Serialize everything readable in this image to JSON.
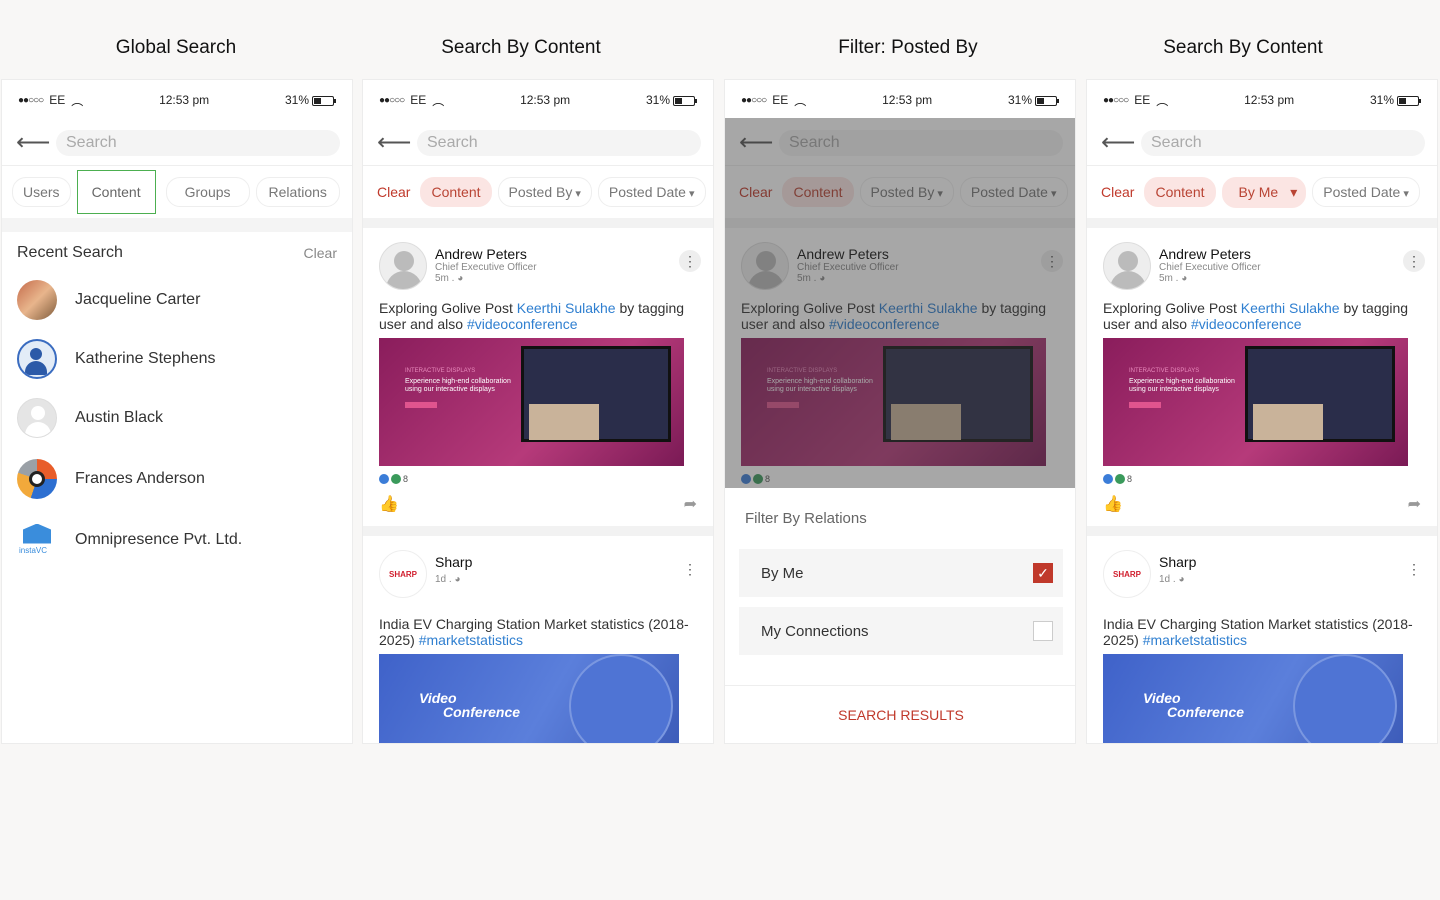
{
  "columns": [
    {
      "title": "Global Search"
    },
    {
      "title": "Search By Content"
    },
    {
      "title": "Filter: Posted By"
    },
    {
      "title": "Search By Content"
    }
  ],
  "status": {
    "carrier": "EE",
    "time": "12:53 pm",
    "battery": "31%"
  },
  "search": {
    "placeholder": "Search"
  },
  "global": {
    "tabs": [
      "Users",
      "Content",
      "Groups",
      "Relations"
    ],
    "recent_title": "Recent Search",
    "clear": "Clear",
    "people": [
      "Jacqueline Carter",
      "Katherine Stephens",
      "Austin Black",
      "Frances Anderson",
      "Omnipresence Pvt. Ltd."
    ],
    "insta_label": "instaVC"
  },
  "filters": {
    "clear": "Clear",
    "content": "Content",
    "posted_by": "Posted By",
    "posted_date": "Posted Date",
    "by_me": "By Me"
  },
  "post1": {
    "name": "Andrew Peters",
    "role": "Chief Executive Officer",
    "time": "5m .",
    "text_pre": "Exploring Golive Post ",
    "mention": "Keerthi Sulakhe",
    "text_mid": " by tagging user and also ",
    "hashtag": "#videoconference",
    "banner_small": "INTERACTIVE DISPLAYS",
    "banner_big": "Experience high-end collaboration using our interactive displays",
    "reactions": "8"
  },
  "post2": {
    "name": "Sharp",
    "logo": "SHARP",
    "time": "1d .",
    "text": "India EV Charging Station Market statistics (2018-2025) ",
    "hashtag": "#marketstatistics",
    "vc1": "Video",
    "vc2": "Conference"
  },
  "sheet": {
    "title": "Filter By Relations",
    "options": [
      "By Me",
      "My Connections"
    ],
    "action": "SEARCH RESULTS"
  }
}
